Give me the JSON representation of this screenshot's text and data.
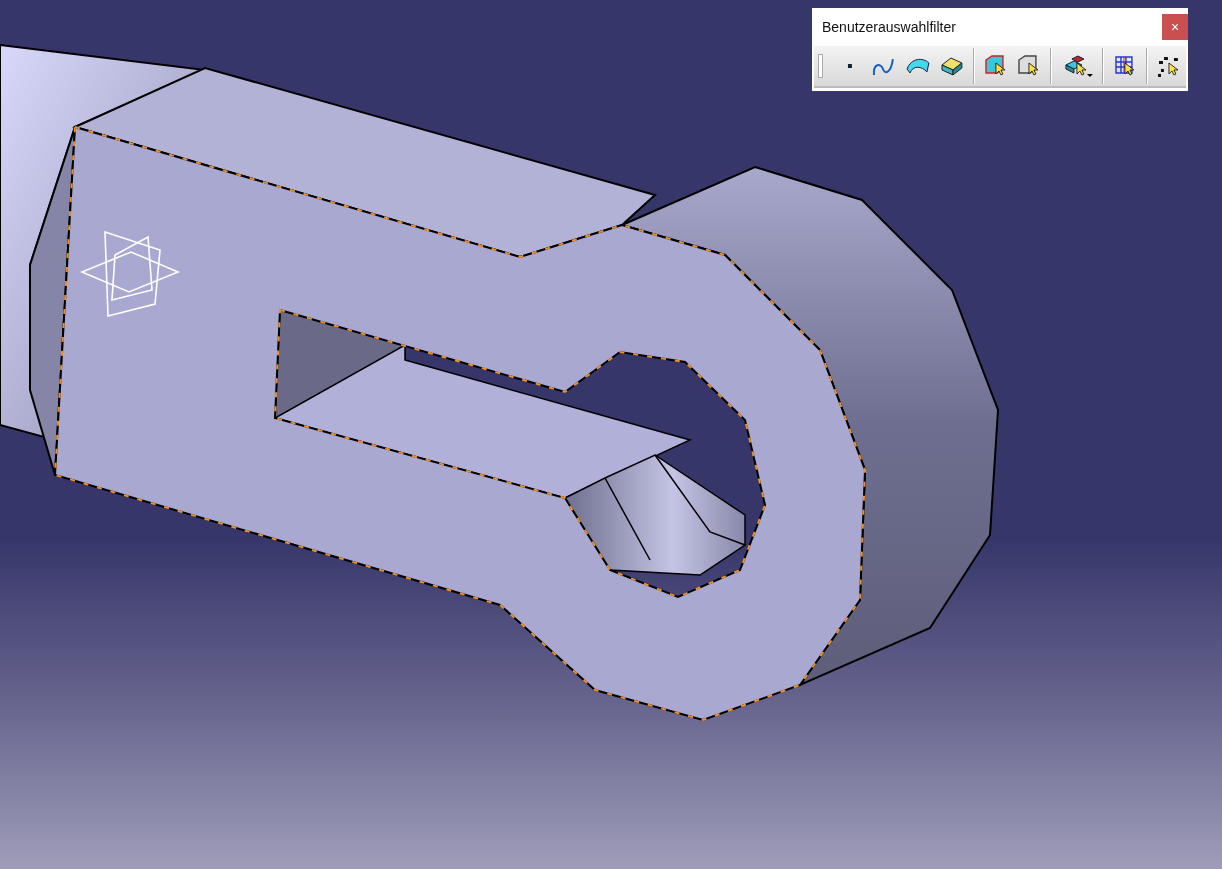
{
  "toolbar": {
    "title": "Benutzerauswahlfilter",
    "close": "×"
  }
}
